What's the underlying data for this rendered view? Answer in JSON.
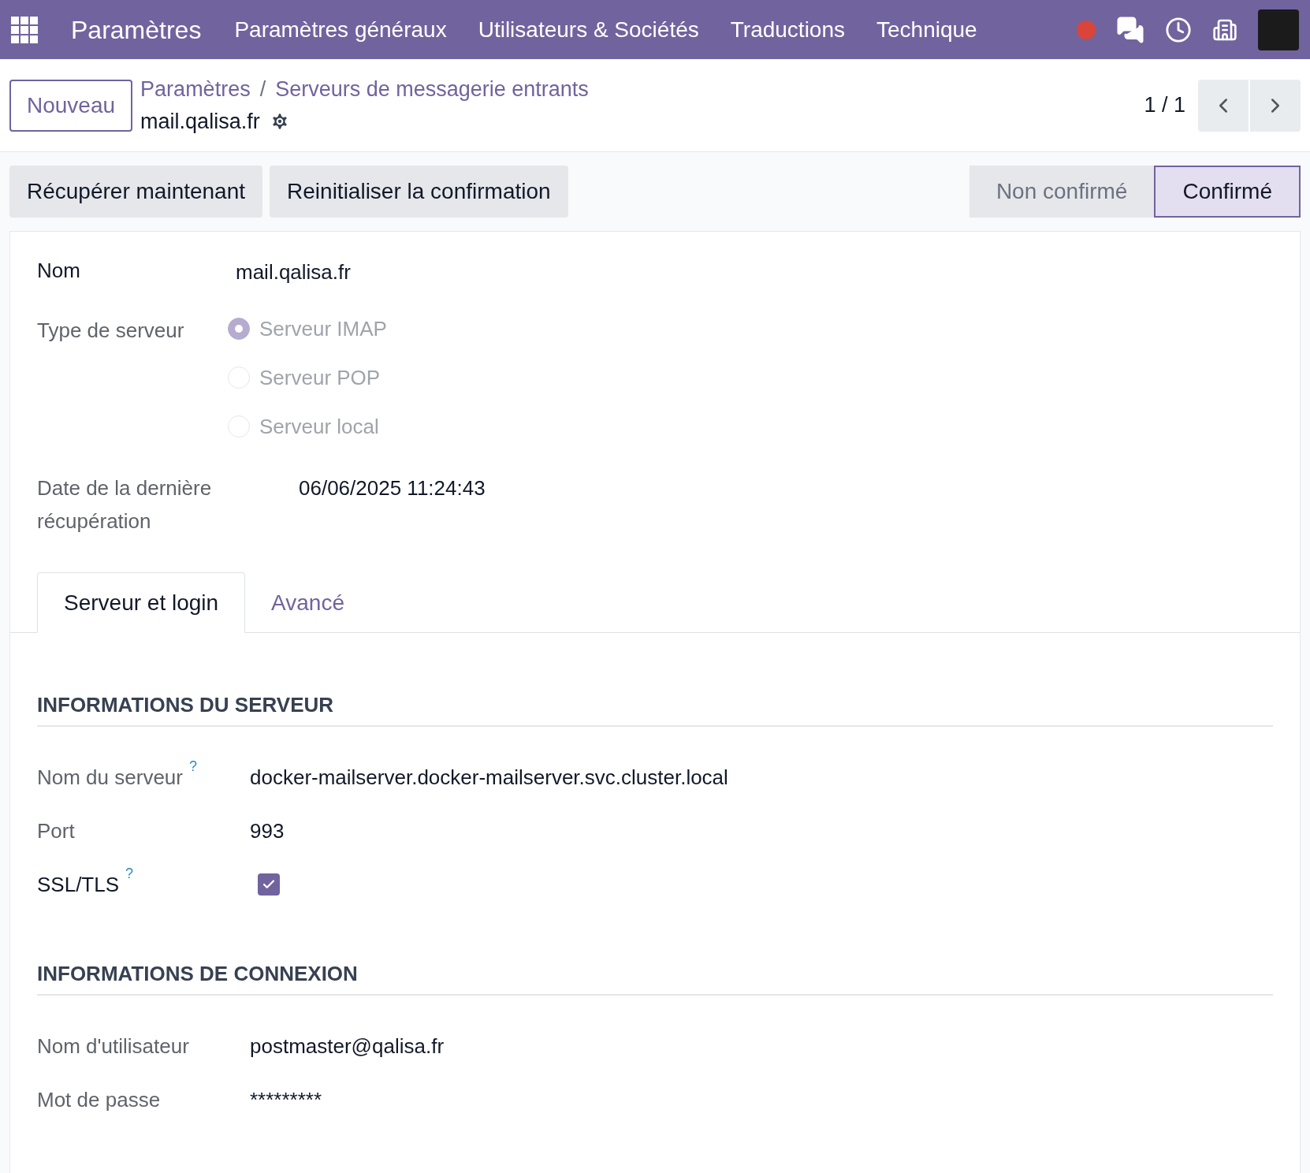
{
  "navbar": {
    "app_name": "Paramètres",
    "menus": [
      "Paramètres généraux",
      "Utilisateurs & Sociétés",
      "Traductions",
      "Technique"
    ]
  },
  "control_panel": {
    "new_button": "Nouveau",
    "breadcrumbs": [
      "Paramètres",
      "Serveurs de messagerie entrants"
    ],
    "breadcrumb_separator": "/",
    "record_name": "mail.qalisa.fr",
    "pager": "1 / 1"
  },
  "actions": [
    "Récupérer maintenant",
    "Reinitialiser la confirmation"
  ],
  "status_steps": [
    {
      "label": "Non confirmé",
      "selected": false
    },
    {
      "label": "Confirmé",
      "selected": true
    }
  ],
  "form": {
    "name": {
      "label": "Nom",
      "value": "mail.qalisa.fr",
      "required": true
    },
    "server_type": {
      "label": "Type de serveur",
      "required": false,
      "options": [
        {
          "label": "Serveur IMAP",
          "selected": true,
          "disabled": true
        },
        {
          "label": "Serveur POP",
          "selected": false,
          "disabled": true
        },
        {
          "label": "Serveur local",
          "selected": false,
          "disabled": true
        }
      ]
    },
    "last_fetch": {
      "label": "Date de la dernière récupération",
      "value": "06/06/2025 11:24:43",
      "required": false
    }
  },
  "tabs": [
    {
      "label": "Serveur et login",
      "selected": true
    },
    {
      "label": "Avancé",
      "selected": false
    }
  ],
  "sections": [
    {
      "title": "INFORMATIONS DU SERVEUR",
      "fields": [
        {
          "kind": "text",
          "label": "Nom du serveur",
          "help": "?",
          "required": false,
          "value": "docker-mailserver.docker-mailserver.svc.cluster.local"
        },
        {
          "kind": "text",
          "label": "Port",
          "required": false,
          "value": "993"
        },
        {
          "kind": "checkbox",
          "label": "SSL/TLS",
          "help": "?",
          "required": true,
          "checked": true
        }
      ]
    },
    {
      "title": "INFORMATIONS DE CONNEXION",
      "fields": [
        {
          "kind": "text",
          "label": "Nom d'utilisateur",
          "required": false,
          "value": "postmaster@qalisa.fr"
        },
        {
          "kind": "text",
          "label": "Mot de passe",
          "required": false,
          "value": "*********"
        }
      ]
    }
  ]
}
